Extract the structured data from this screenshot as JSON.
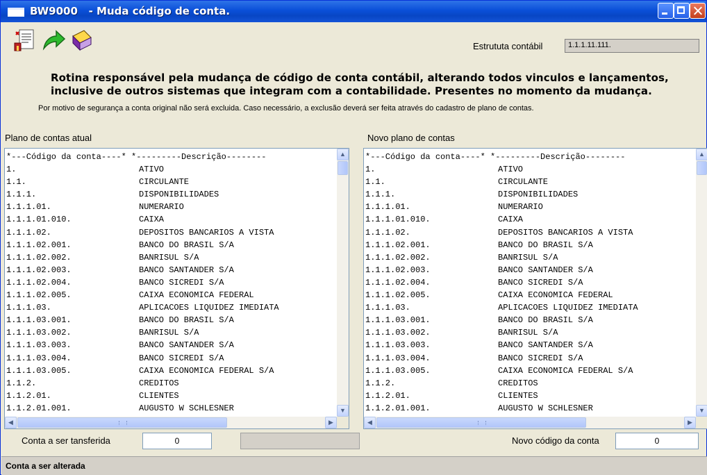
{
  "window": {
    "title": "BW9000   - Muda código de conta."
  },
  "toolbar": {
    "icons": [
      "report-icon",
      "arrow-forward-icon",
      "book-icon"
    ]
  },
  "estrutura": {
    "label": "Estrututa contábil",
    "value": "1.1.1.11.111."
  },
  "header": {
    "line1": "Rotina responsável pela mudança de código de conta contábil, alterando todos vinculos e lançamentos,",
    "line2": "inclusive de outros sistemas que integram com a contabilidade. Presentes no momento da mudança.",
    "note": "Por motivo de segurança a conta original não será excluida. Caso necessário, a exclusão deverá ser feita através do cadastro de plano de contas."
  },
  "left_panel": {
    "label": "Plano de contas atual"
  },
  "right_panel": {
    "label": "Novo plano de contas"
  },
  "list_header": "*---Código da conta----* *---------Descrição--------",
  "accounts": [
    {
      "code": "1.",
      "desc": "ATIVO"
    },
    {
      "code": "1.1.",
      "desc": "CIRCULANTE"
    },
    {
      "code": "1.1.1.",
      "desc": "DISPONIBILIDADES"
    },
    {
      "code": "1.1.1.01.",
      "desc": "NUMERARIO"
    },
    {
      "code": "1.1.1.01.010.",
      "desc": "CAIXA"
    },
    {
      "code": "1.1.1.02.",
      "desc": "DEPOSITOS BANCARIOS A VISTA"
    },
    {
      "code": "1.1.1.02.001.",
      "desc": "BANCO DO BRASIL S/A"
    },
    {
      "code": "1.1.1.02.002.",
      "desc": "BANRISUL S/A"
    },
    {
      "code": "1.1.1.02.003.",
      "desc": "BANCO SANTANDER S/A"
    },
    {
      "code": "1.1.1.02.004.",
      "desc": "BANCO SICREDI S/A"
    },
    {
      "code": "1.1.1.02.005.",
      "desc": "CAIXA ECONOMICA FEDERAL"
    },
    {
      "code": "1.1.1.03.",
      "desc": "APLICACOES LIQUIDEZ IMEDIATA"
    },
    {
      "code": "1.1.1.03.001.",
      "desc": "BANCO DO BRASIL S/A"
    },
    {
      "code": "1.1.1.03.002.",
      "desc": "BANRISUL S/A"
    },
    {
      "code": "1.1.1.03.003.",
      "desc": "BANCO SANTANDER S/A"
    },
    {
      "code": "1.1.1.03.004.",
      "desc": "BANCO SICREDI S/A"
    },
    {
      "code": "1.1.1.03.005.",
      "desc": "CAIXA ECONOMICA FEDERAL S/A"
    },
    {
      "code": "1.1.2.",
      "desc": "CREDITOS"
    },
    {
      "code": "1.1.2.01.",
      "desc": "CLIENTES"
    },
    {
      "code": "1.1.2.01.001.",
      "desc": "AUGUSTO W SCHLESNER"
    }
  ],
  "footer": {
    "transfer_label": "Conta a ser tansferida",
    "transfer_value": "0",
    "new_code_label": "Novo código da conta",
    "new_code_value": "0"
  },
  "status": {
    "text": "Conta a ser alterada"
  },
  "colors": {
    "titlebar": "#0a4fd8",
    "window_bg": "#ece9d8",
    "close": "#c4401d"
  }
}
